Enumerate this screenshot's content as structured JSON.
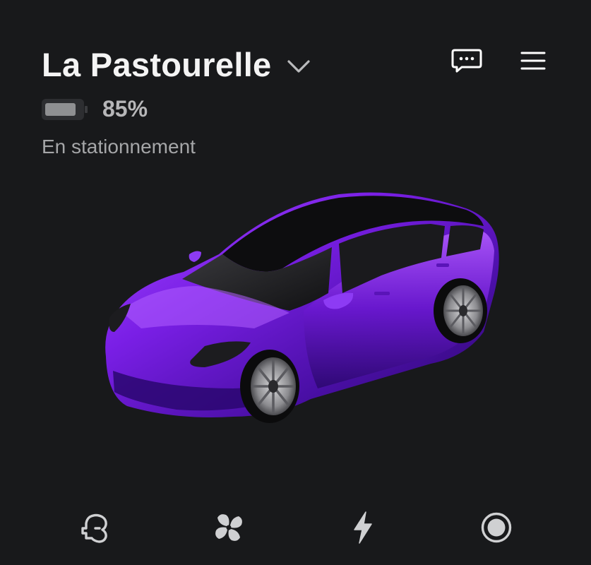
{
  "vehicle": {
    "name": "La Pastourelle",
    "battery_percent_label": "85%",
    "battery_level": 0.85,
    "status": "En stationnement",
    "paint_color": "#7a1fe6"
  },
  "header_actions": [
    {
      "icon": "chat-bubble-icon"
    },
    {
      "icon": "menu-icon"
    }
  ],
  "bottom_nav": [
    {
      "icon": "lock-icon"
    },
    {
      "icon": "fan-icon"
    },
    {
      "icon": "lightning-icon"
    },
    {
      "icon": "record-icon"
    }
  ],
  "colors": {
    "background": "#18191b",
    "text_primary": "#f4f4f4",
    "text_secondary": "#a5a6a8",
    "icon": "#cfd0d2"
  }
}
